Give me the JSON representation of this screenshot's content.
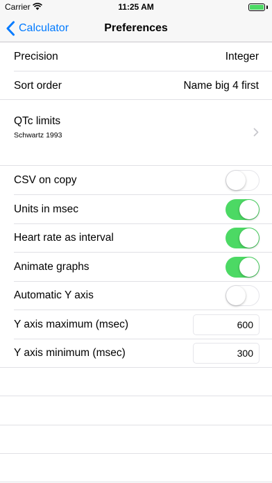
{
  "status_bar": {
    "carrier": "Carrier",
    "time": "11:25 AM",
    "battery_level": 1.0,
    "battery_color": "#4cd964"
  },
  "nav": {
    "back_label": "Calculator",
    "title": "Preferences",
    "tint": "#007aff"
  },
  "settings": {
    "precision": {
      "label": "Precision",
      "value": "Integer"
    },
    "sort_order": {
      "label": "Sort order",
      "value": "Name big 4 first"
    },
    "qtc_limits": {
      "label": "QTc limits",
      "detail": "Schwartz 1993"
    },
    "csv_on_copy": {
      "label": "CSV on copy",
      "on": false
    },
    "units_in_msec": {
      "label": "Units in msec",
      "on": true
    },
    "heart_rate_interval": {
      "label": "Heart rate as interval",
      "on": true
    },
    "animate_graphs": {
      "label": "Animate graphs",
      "on": true
    },
    "automatic_y_axis": {
      "label": "Automatic Y axis",
      "on": false
    },
    "y_axis_max": {
      "label": "Y axis maximum (msec)",
      "value": "600"
    },
    "y_axis_min": {
      "label": "Y axis minimum (msec)",
      "value": "300"
    }
  },
  "colors": {
    "switch_on": "#4cd964",
    "separator": "#e0e0e5"
  }
}
